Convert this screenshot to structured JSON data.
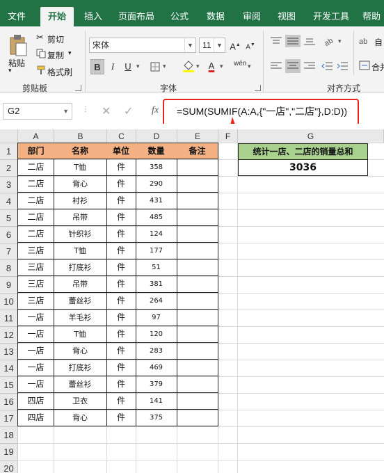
{
  "ribbon_tabs": [
    {
      "label": "文件"
    },
    {
      "label": "开始"
    },
    {
      "label": "插入"
    },
    {
      "label": "页面布局"
    },
    {
      "label": "公式"
    },
    {
      "label": "数据"
    },
    {
      "label": "审阅"
    },
    {
      "label": "视图"
    },
    {
      "label": "开发工具"
    },
    {
      "label": "帮助"
    }
  ],
  "clipboard": {
    "paste_label": "粘贴",
    "cut_label": "剪切",
    "copy_label": "复制",
    "format_painter_label": "格式刷",
    "group_label": "剪贴板"
  },
  "font": {
    "font_name": "宋体",
    "font_size": "11",
    "grow_label": "A",
    "shrink_label": "A",
    "bold_label": "B",
    "italic_label": "I",
    "underline_label": "U",
    "font_color_label": "A",
    "phonetic_label": "wén",
    "group_label": "字体",
    "font_color": "#e02020",
    "fill_color": "#ffff00"
  },
  "alignment": {
    "group_label": "对齐方式",
    "wrap_label": "自",
    "merge_label": "合并"
  },
  "formula_bar": {
    "name_box": "G2",
    "fx_label": "fx",
    "formula": "=SUM(SUMIF(A:A,{\"一店\",\"二店\"},D:D))"
  },
  "column_headers": [
    "A",
    "B",
    "C",
    "D",
    "E",
    "F",
    "G"
  ],
  "row_headers": [
    "1",
    "2",
    "3",
    "4",
    "5",
    "6",
    "7",
    "8",
    "9",
    "10",
    "11",
    "12",
    "13",
    "14",
    "15",
    "16",
    "17",
    "18",
    "19",
    "20"
  ],
  "table": {
    "headers": [
      "部门",
      "名称",
      "单位",
      "数量",
      "备注"
    ],
    "rows": [
      [
        "二店",
        "T恤",
        "件",
        "358",
        ""
      ],
      [
        "二店",
        "背心",
        "件",
        "290",
        ""
      ],
      [
        "二店",
        "衬衫",
        "件",
        "431",
        ""
      ],
      [
        "二店",
        "吊带",
        "件",
        "485",
        ""
      ],
      [
        "二店",
        "针织衫",
        "件",
        "124",
        ""
      ],
      [
        "三店",
        "T恤",
        "件",
        "177",
        ""
      ],
      [
        "三店",
        "打底衫",
        "件",
        "51",
        ""
      ],
      [
        "三店",
        "吊带",
        "件",
        "381",
        ""
      ],
      [
        "三店",
        "蕾丝衫",
        "件",
        "264",
        ""
      ],
      [
        "一店",
        "羊毛衫",
        "件",
        "97",
        ""
      ],
      [
        "一店",
        "T恤",
        "件",
        "120",
        ""
      ],
      [
        "一店",
        "背心",
        "件",
        "283",
        ""
      ],
      [
        "一店",
        "打底衫",
        "件",
        "469",
        ""
      ],
      [
        "一店",
        "蕾丝衫",
        "件",
        "379",
        ""
      ],
      [
        "四店",
        "卫衣",
        "件",
        "141",
        ""
      ],
      [
        "四店",
        "背心",
        "件",
        "375",
        ""
      ]
    ]
  },
  "summary": {
    "title": "统计一店、二店的销量总和",
    "value": "3036",
    "title_bg": "#a9d18e"
  },
  "colors": {
    "excel_green": "#217346",
    "header_fill": "#f4b183",
    "annotation_red": "#e8251e"
  }
}
